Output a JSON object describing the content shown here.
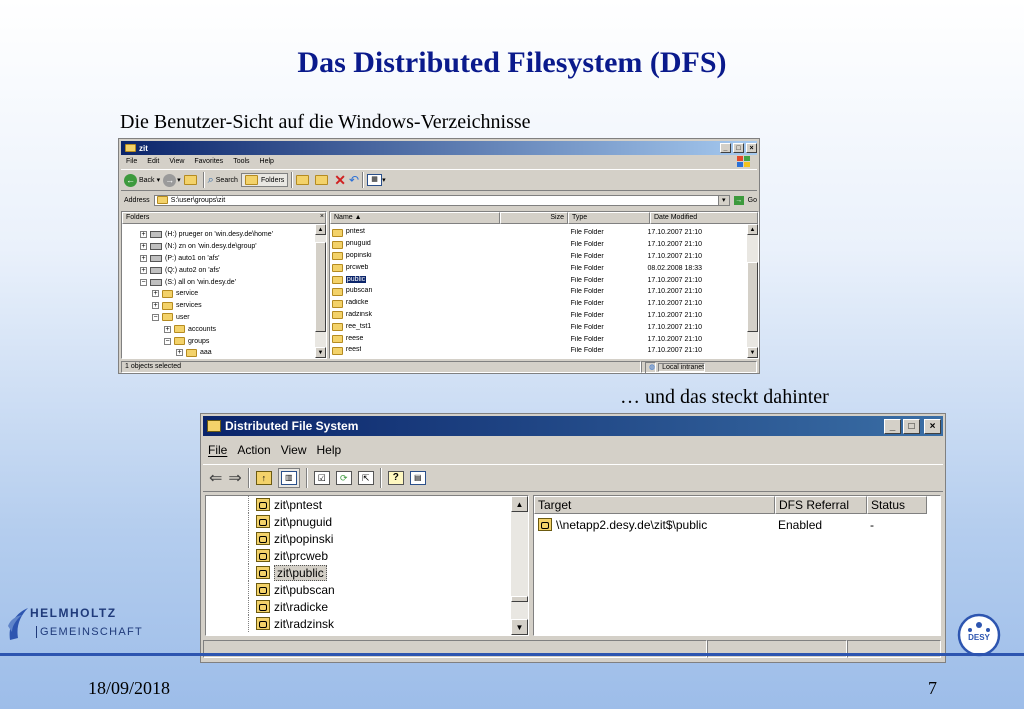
{
  "slide": {
    "title": "Das Distributed Filesystem (DFS)",
    "subtitle1": "Die Benutzer-Sicht auf die Windows-Verzeichnisse",
    "subtitle2": "… und das steckt dahinter",
    "date": "18/09/2018",
    "page": "7",
    "logo_left_line1": "HELMHOLTZ",
    "logo_left_line2": "GEMEINSCHAFT",
    "logo_right": "DESY"
  },
  "explorer": {
    "title": "zit",
    "menu": [
      "File",
      "Edit",
      "View",
      "Favorites",
      "Tools",
      "Help"
    ],
    "toolbar": {
      "back": "Back",
      "search": "Search",
      "folders": "Folders"
    },
    "address_label": "Address",
    "address_value": "S:\\user\\groups\\zit",
    "go_label": "Go",
    "folders_header": "Folders",
    "tree": [
      {
        "label": "(H:) prueger on 'win.desy.de\\home'",
        "indent": 0,
        "kind": "drive",
        "exp": "+"
      },
      {
        "label": "(N:) zn on 'win.desy.de\\group'",
        "indent": 0,
        "kind": "drive",
        "exp": "+"
      },
      {
        "label": "(P:) auto1 on 'afs'",
        "indent": 0,
        "kind": "drive",
        "exp": "+"
      },
      {
        "label": "(Q:) auto2 on 'afs'",
        "indent": 0,
        "kind": "drive",
        "exp": "+"
      },
      {
        "label": "(S:) all on 'win.desy.de'",
        "indent": 0,
        "kind": "drive",
        "exp": "−"
      },
      {
        "label": "service",
        "indent": 1,
        "kind": "folder",
        "exp": "+"
      },
      {
        "label": "services",
        "indent": 1,
        "kind": "folder",
        "exp": "+"
      },
      {
        "label": "user",
        "indent": 1,
        "kind": "folder",
        "exp": "−"
      },
      {
        "label": "accounts",
        "indent": 2,
        "kind": "folder",
        "exp": "+"
      },
      {
        "label": "groups",
        "indent": 2,
        "kind": "folder",
        "exp": "−"
      },
      {
        "label": "aaa",
        "indent": 3,
        "kind": "folder",
        "exp": "+"
      }
    ],
    "columns": [
      "Name",
      "Size",
      "Type",
      "Date Modified"
    ],
    "files": [
      {
        "name": "pntest",
        "size": "",
        "type": "File Folder",
        "date": "17.10.2007 21:10"
      },
      {
        "name": "pnuguid",
        "size": "",
        "type": "File Folder",
        "date": "17.10.2007 21:10"
      },
      {
        "name": "popinski",
        "size": "",
        "type": "File Folder",
        "date": "17.10.2007 21:10"
      },
      {
        "name": "prcweb",
        "size": "",
        "type": "File Folder",
        "date": "08.02.2008 18:33"
      },
      {
        "name": "public",
        "size": "",
        "type": "File Folder",
        "date": "17.10.2007 21:10",
        "selected": true
      },
      {
        "name": "pubscan",
        "size": "",
        "type": "File Folder",
        "date": "17.10.2007 21:10"
      },
      {
        "name": "radicke",
        "size": "",
        "type": "File Folder",
        "date": "17.10.2007 21:10"
      },
      {
        "name": "radzinsk",
        "size": "",
        "type": "File Folder",
        "date": "17.10.2007 21:10"
      },
      {
        "name": "ree_tst1",
        "size": "",
        "type": "File Folder",
        "date": "17.10.2007 21:10"
      },
      {
        "name": "reese",
        "size": "",
        "type": "File Folder",
        "date": "17.10.2007 21:10"
      },
      {
        "name": "reest",
        "size": "",
        "type": "File Folder",
        "date": "17.10.2007 21:10"
      }
    ],
    "status_left": "1 objects selected",
    "status_right": "Local intranet"
  },
  "dfs": {
    "title": "Distributed File System",
    "menu": [
      "File",
      "Action",
      "View",
      "Help"
    ],
    "tree": [
      "zit\\pntest",
      "zit\\pnuguid",
      "zit\\popinski",
      "zit\\prcweb",
      "zit\\public",
      "zit\\pubscan",
      "zit\\radicke",
      "zit\\radzinsk"
    ],
    "selected_index": 4,
    "columns": [
      "Target",
      "DFS Referral",
      "Status"
    ],
    "targets": [
      {
        "target": "\\\\netapp2.desy.de\\zit$\\public",
        "referral": "Enabled",
        "status": "-"
      }
    ]
  },
  "colors": {
    "title_blue": "#0a1a8c",
    "titlebar_dark": "#0a246a",
    "selection": "#0a246a",
    "window_face": "#d4d0c8"
  }
}
